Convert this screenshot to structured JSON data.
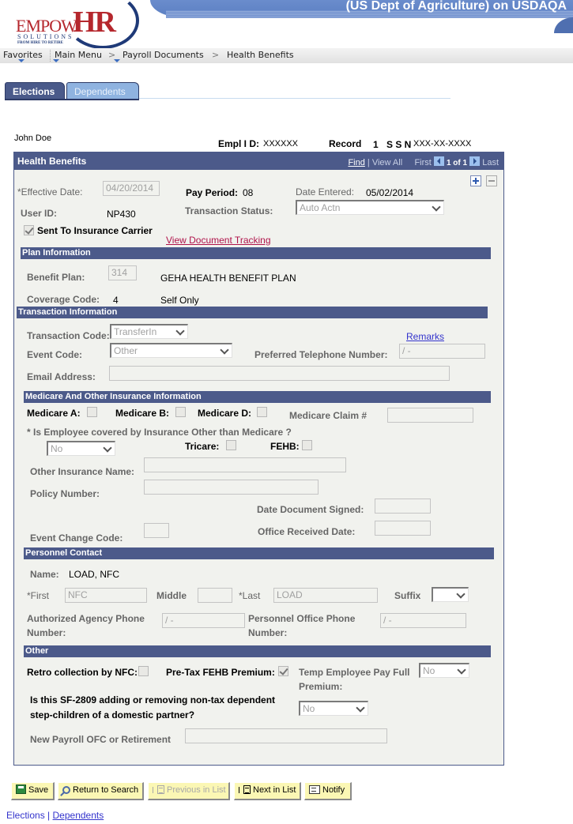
{
  "header": {
    "banner_title": "(US Dept of Agriculture) on USDAQA",
    "logo": {
      "brand_a": "EMPOW",
      "brand_b": "HR",
      "solutions": "SOLUTIONS",
      "tagline": "FROM HIRE TO RETIRE"
    }
  },
  "breadcrumb": {
    "items": [
      "Favorites",
      "Main Menu",
      "Payroll Documents",
      "Health Benefits"
    ],
    "separator": ">"
  },
  "tabs": [
    {
      "label": "Elections",
      "active": true
    },
    {
      "label": "Dependents",
      "active": false
    }
  ],
  "employee": {
    "name": "John Doe",
    "empl_id_label": "Empl I D:",
    "empl_id": "XXXXXX",
    "record_label": "Record",
    "record": "1",
    "ssn_label": "S S N",
    "ssn": "XXX-XX-XXXX"
  },
  "panel": {
    "title": "Health Benefits",
    "find": "Find",
    "view_all": "View All",
    "first": "First",
    "count": "1 of 1",
    "last": "Last"
  },
  "top": {
    "effective_date_label": "*Effective Date:",
    "effective_date": "04/20/2014",
    "pay_period_label": "Pay Period:",
    "pay_period": "08",
    "date_entered_label": "Date Entered:",
    "date_entered": "05/02/2014",
    "user_id_label": "User ID:",
    "user_id": "NP430",
    "transaction_status_label": "Transaction Status:",
    "transaction_status": "Auto Actn",
    "sent_to_carrier_label": "Sent To Insurance Carrier",
    "sent_to_carrier": true,
    "view_doc_tracking": "View Document Tracking"
  },
  "plan": {
    "section": "Plan Information",
    "benefit_plan_label": "Benefit Plan:",
    "benefit_plan": "314",
    "benefit_plan_desc": "GEHA HEALTH BENEFIT PLAN",
    "coverage_code_label": "Coverage Code:",
    "coverage_code": "4",
    "coverage_desc": "Self Only"
  },
  "transaction": {
    "section": "Transaction Information",
    "transaction_code_label": "Transaction Code:",
    "transaction_code": "TransferIn",
    "remarks": "Remarks",
    "event_code_label": "Event Code:",
    "event_code": "Other",
    "phone_label": "Preferred Telephone Number:",
    "phone": "/  -",
    "email_label": "Email Address:",
    "email": ""
  },
  "medicare": {
    "section": "Medicare And Other Insurance Information",
    "medicare_a_label": "Medicare A:",
    "medicare_a": false,
    "medicare_b_label": "Medicare B:",
    "medicare_b": false,
    "medicare_d_label": "Medicare D:",
    "medicare_d": false,
    "claim_label": "Medicare Claim #",
    "claim": "",
    "other_ins_question": "* Is Employee covered by Insurance Other than Medicare ?",
    "other_ins_value": "No",
    "tricare_label": "Tricare:",
    "tricare": false,
    "fehb_label": "FEHB:",
    "fehb": false,
    "other_ins_name_label": "Other Insurance Name:",
    "other_ins_name": "",
    "policy_number_label": "Policy Number:",
    "policy_number": "",
    "date_signed_label": "Date Document Signed:",
    "date_signed": "",
    "event_change_label": "Event Change Code:",
    "event_change": "",
    "office_received_label": "Office Received Date:",
    "office_received": ""
  },
  "personnel": {
    "section": "Personnel Contact",
    "name_label": "Name:",
    "name": "LOAD, NFC",
    "first_label": "*First",
    "first": "NFC",
    "middle_label": "Middle",
    "middle": "",
    "last_label": "*Last",
    "last": "LOAD",
    "suffix_label": "Suffix",
    "suffix": "",
    "agency_phone_label_1": "Authorized Agency Phone",
    "agency_phone_label_2": "Number:",
    "agency_phone": "/  -",
    "office_phone_label_1": "Personnel Office Phone",
    "office_phone_label_2": "Number:",
    "office_phone": "/  -"
  },
  "other": {
    "section": "Other",
    "retro_label": "Retro collection by NFC:",
    "retro": false,
    "pretax_label": "Pre-Tax FEHB Premium:",
    "pretax": true,
    "temp_label_1": "Temp Employee Pay Full",
    "temp_label_2": "Premium:",
    "temp_value": "No",
    "sf2809_label_1": "Is this SF-2809 adding or removing non-tax dependent",
    "sf2809_label_2": "step-children of a domestic partner?",
    "sf2809_value": "No",
    "new_payroll_label": "New Payroll OFC or Retirement",
    "new_payroll": ""
  },
  "toolbar": {
    "save": "Save",
    "return_to_search": "Return to Search",
    "previous_in_list": "Previous in List",
    "next_in_list": "Next in List",
    "notify": "Notify"
  },
  "footer": {
    "current": "Elections",
    "separator": "|",
    "link": "Dependents"
  }
}
